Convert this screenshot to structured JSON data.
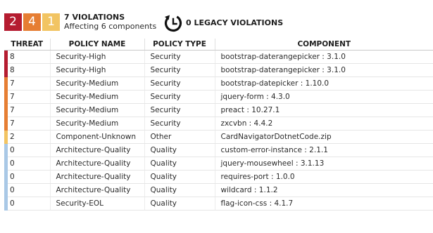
{
  "summary": {
    "badges": [
      {
        "value": "2",
        "color": "#b51c30"
      },
      {
        "value": "4",
        "color": "#e67e33"
      },
      {
        "value": "1",
        "color": "#f2c462"
      }
    ],
    "violations_title": "7 VIOLATIONS",
    "violations_sub": "Affecting 6 components",
    "legacy_icon": "waiver-clock-icon",
    "legacy_label": "0 LEGACY VIOLATIONS"
  },
  "table": {
    "headers": [
      "THREAT",
      "POLICY NAME",
      "POLICY TYPE",
      "COMPONENT"
    ],
    "rows": [
      {
        "threat": "8",
        "color": "#b51c30",
        "policy": "Security-High",
        "type": "Security",
        "component": "bootstrap-daterangepicker : 3.1.0"
      },
      {
        "threat": "8",
        "color": "#b51c30",
        "policy": "Security-High",
        "type": "Security",
        "component": "bootstrap-daterangepicker : 3.1.0"
      },
      {
        "threat": "7",
        "color": "#e67e33",
        "policy": "Security-Medium",
        "type": "Security",
        "component": "bootstrap-datepicker : 1.10.0"
      },
      {
        "threat": "7",
        "color": "#e67e33",
        "policy": "Security-Medium",
        "type": "Security",
        "component": "jquery-form : 4.3.0"
      },
      {
        "threat": "7",
        "color": "#e67e33",
        "policy": "Security-Medium",
        "type": "Security",
        "component": "preact : 10.27.1"
      },
      {
        "threat": "7",
        "color": "#e67e33",
        "policy": "Security-Medium",
        "type": "Security",
        "component": "zxcvbn : 4.4.2"
      },
      {
        "threat": "2",
        "color": "#f2c462",
        "policy": "Component-Unknown",
        "type": "Other",
        "component": "CardNavigatorDotnetCode.zip"
      },
      {
        "threat": "0",
        "color": "#a9c8e6",
        "policy": "Architecture-Quality",
        "type": "Quality",
        "component": "custom-error-instance : 2.1.1"
      },
      {
        "threat": "0",
        "color": "#a9c8e6",
        "policy": "Architecture-Quality",
        "type": "Quality",
        "component": "jquery-mousewheel : 3.1.13"
      },
      {
        "threat": "0",
        "color": "#a9c8e6",
        "policy": "Architecture-Quality",
        "type": "Quality",
        "component": "requires-port : 1.0.0"
      },
      {
        "threat": "0",
        "color": "#a9c8e6",
        "policy": "Architecture-Quality",
        "type": "Quality",
        "component": "wildcard : 1.1.2"
      },
      {
        "threat": "0",
        "color": "#a9c8e6",
        "policy": "Security-EOL",
        "type": "Quality",
        "component": "flag-icon-css : 4.1.7"
      }
    ]
  }
}
